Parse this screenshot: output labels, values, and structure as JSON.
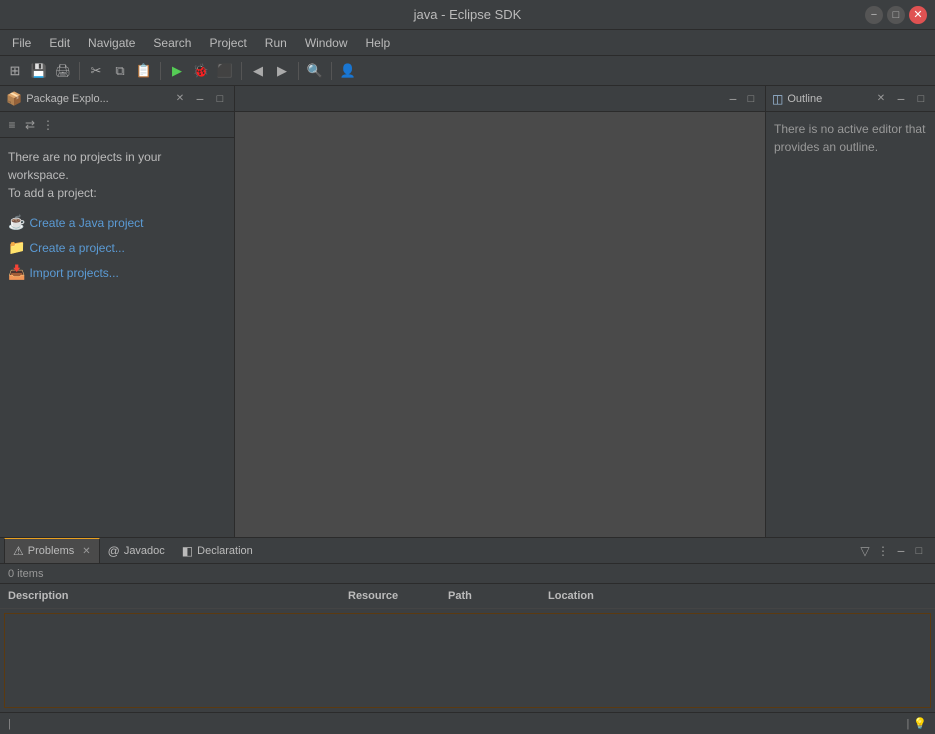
{
  "title_bar": {
    "title": "java - Eclipse SDK",
    "minimize_label": "−",
    "maximize_label": "□",
    "close_label": "✕"
  },
  "menu": {
    "items": [
      "File",
      "Edit",
      "Navigate",
      "Search",
      "Project",
      "Run",
      "Window",
      "Help"
    ]
  },
  "package_explorer": {
    "title": "Package Explo...",
    "no_projects_line1": "There are no projects in your",
    "no_projects_line2": "workspace.",
    "add_project_label": "To add a project:",
    "links": [
      {
        "label": "Create a Java project",
        "icon": "☕"
      },
      {
        "label": "Create a project...",
        "icon": "📁"
      },
      {
        "label": "Import projects...",
        "icon": "📥"
      }
    ]
  },
  "outline": {
    "title": "Outline",
    "no_editor_text": "There is no active editor that provides an outline."
  },
  "bottom_panel": {
    "tabs": [
      {
        "label": "Problems",
        "icon": "⚠",
        "active": true
      },
      {
        "label": "Javadoc",
        "icon": "@"
      },
      {
        "label": "Declaration",
        "icon": "◧"
      }
    ],
    "items_count": "0 items",
    "columns": [
      "Description",
      "Resource",
      "Path",
      "Location"
    ]
  },
  "status_bar": {
    "left": "",
    "right": "💡"
  },
  "icons": {
    "filter": "▽",
    "more_options": "⋮",
    "minimize": "−",
    "maximize": "□",
    "close": "✕",
    "sync": "⇄",
    "collapse": "⊟",
    "more": "⋮",
    "search": "🔍"
  }
}
